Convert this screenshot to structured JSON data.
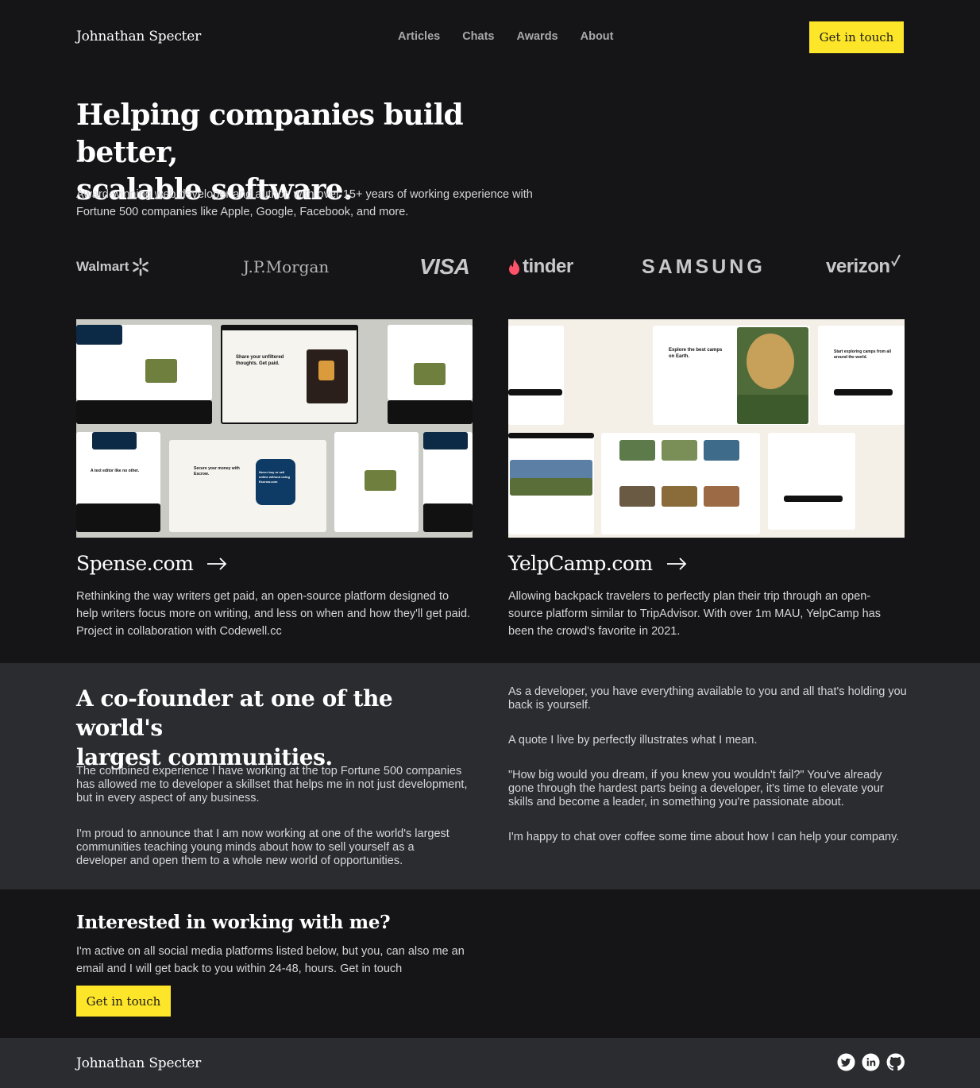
{
  "header": {
    "brand": "Johnathan Specter",
    "nav": [
      "Articles",
      "Chats",
      "Awards",
      "About"
    ],
    "cta": "Get in touch"
  },
  "hero": {
    "title_line1": "Helping companies build better,",
    "title_line2": "scalable software.",
    "subtitle_line1": "Award-winning web developer and author, with over 15+ years of working experience with",
    "subtitle_line2": "Fortune 500 companies like Apple, Google, Facebook, and more."
  },
  "logos": [
    "Walmart",
    "J.P.Morgan",
    "VISA",
    "tinder",
    "SAMSUNG",
    "verizon"
  ],
  "projects": [
    {
      "title": "Spense.com",
      "desc": "Rethinking the way writers get paid, an open-source platform designed to help writers focus more on writing, and less on when and how they'll get paid. Project in collaboration with Codewell.cc",
      "shot_text": [
        "Share your unfiltered thoughts. Get paid.",
        "Secure your money with Escrow.",
        "Never buy or sell online without using Escrow.com",
        "A text editor like no other."
      ]
    },
    {
      "title": "YelpCamp.com",
      "desc": "Allowing backpack travelers to perfectly plan their trip through an open-source platform similar to TripAdvisor. With over 1m MAU, YelpCamp has been the crowd's favorite in 2021.",
      "shot_text": [
        "Explore the best camps on Earth.",
        "Start exploring camps from all around the world."
      ]
    }
  ],
  "about": {
    "title_line1": "A co-founder at one of the world's",
    "title_line2": "largest communities.",
    "left_p1": "The combined experience I have working at the top Fortune 500 companies has allowed me to developer a skillset that helps me in not just development, but in every aspect of any business.",
    "left_p2": "I'm proud to announce that I am now working at one of the world's largest communities teaching young minds about how to sell yourself as a developer and open them to a whole new world of opportunities.",
    "right_p1": "As a developer, you have everything available to you and all that's holding you back is yourself.",
    "right_p2": "A quote I live by perfectly illustrates what I mean.",
    "right_p3": "\"How big would you dream, if you knew you wouldn't fail?\" You've already gone through the hardest parts being a developer, it's time to elevate your skills and become a leader, in something you're passionate about.",
    "right_p4": "I'm happy to chat over coffee some time about how I can help your company."
  },
  "contact": {
    "title": "Interested in working with me?",
    "text": "I'm active on all social media platforms listed below, but you, can also me an email and I will get back to you within 24-48, hours. Get in touch",
    "cta": "Get in touch"
  },
  "footer": {
    "brand": "Johnathan Specter",
    "social": [
      "twitter-icon",
      "linkedin-icon",
      "github-icon"
    ]
  },
  "colors": {
    "background": "#151416",
    "panel": "#2b2c30",
    "accent": "#fde529"
  }
}
